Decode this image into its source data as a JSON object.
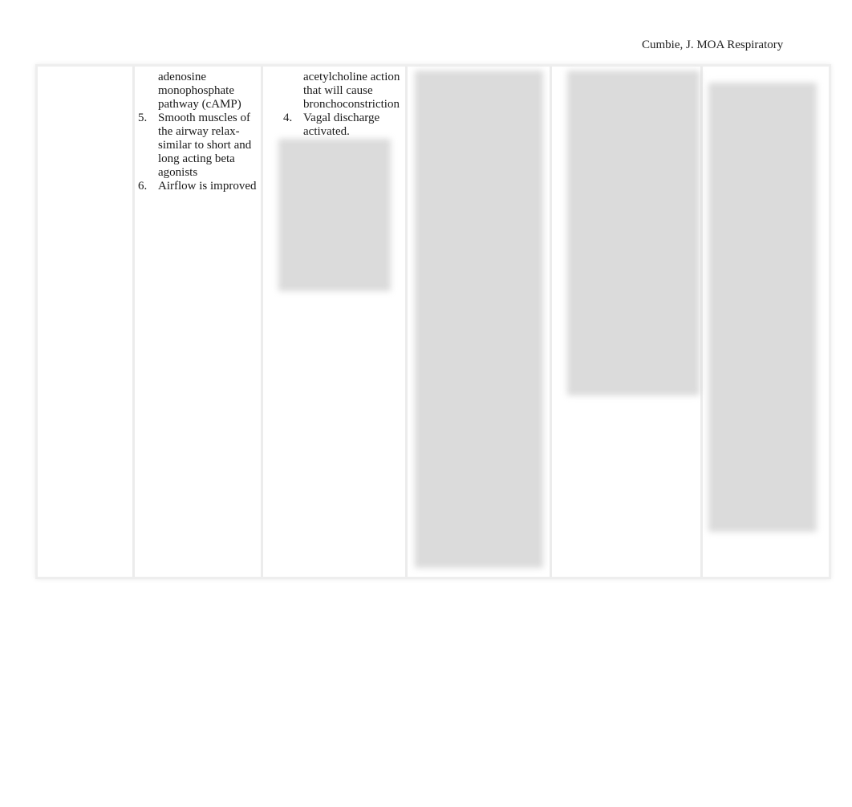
{
  "header": {
    "text": "Cumbie, J. MOA Respiratory"
  },
  "columns": {
    "col2": {
      "continuation": "adenosine monophosphate pathway (cAMP)",
      "items": [
        {
          "num": "5.",
          "text": "Smooth muscles of the airway relax- similar to short and long acting beta agonists"
        },
        {
          "num": "6.",
          "text": "Airflow is improved"
        }
      ]
    },
    "col3": {
      "continuation": "acetylcholine action that will cause bronchoconstriction",
      "items": [
        {
          "num": "4.",
          "text": "Vagal discharge activated."
        }
      ]
    }
  }
}
